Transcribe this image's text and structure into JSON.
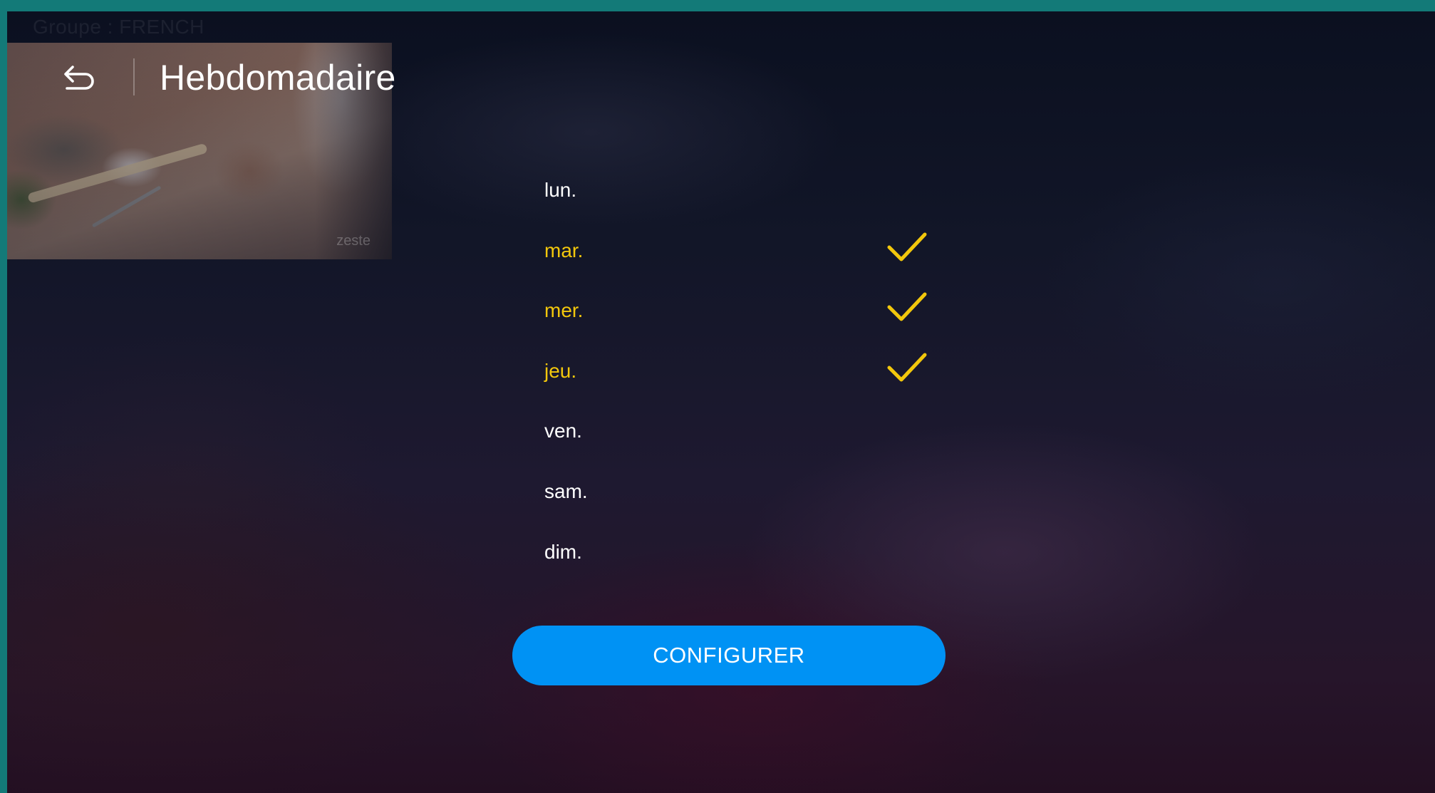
{
  "background_label": "Groupe : FRENCH",
  "thumbnail": {
    "watermark": "zeste"
  },
  "header": {
    "back_icon": "back-arrow-icon",
    "title": "Hebdomadaire"
  },
  "days": [
    {
      "label": "lun.",
      "selected": false
    },
    {
      "label": "mar.",
      "selected": true
    },
    {
      "label": "mer.",
      "selected": true
    },
    {
      "label": "jeu.",
      "selected": true
    },
    {
      "label": "ven.",
      "selected": false
    },
    {
      "label": "sam.",
      "selected": false
    },
    {
      "label": "dim.",
      "selected": false
    }
  ],
  "check_icon": "checkmark-icon",
  "configure_button": {
    "label": "CONFIGURER"
  },
  "colors": {
    "frame": "#137a78",
    "selected_text": "#f2c70c",
    "check": "#f2c70c",
    "button": "#0092f4",
    "text": "#ffffff"
  }
}
